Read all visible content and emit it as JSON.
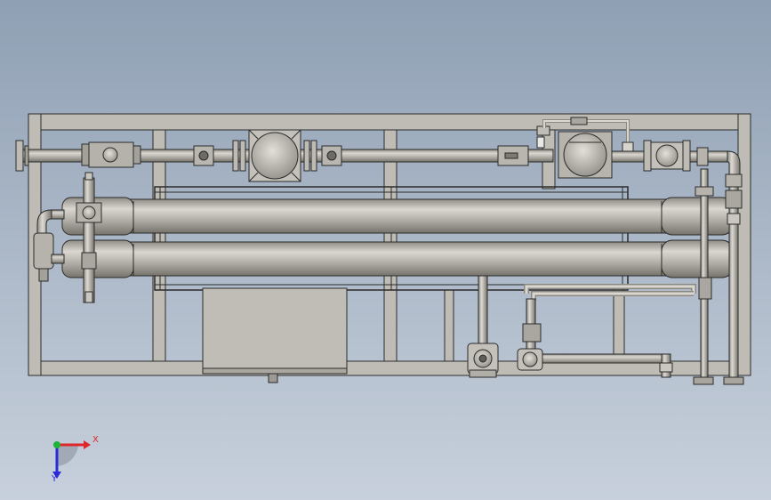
{
  "view": {
    "background_top": "#8fa0b4",
    "background_bottom": "#c7d0dc",
    "model_fill": "#bfbdb5",
    "model_stroke": "#2b2b2b"
  },
  "triad": {
    "x_label": "X",
    "y_label": "Y",
    "x_color": "#e0262a",
    "y_color": "#2a2ad8",
    "origin_color": "#1fb33a"
  }
}
